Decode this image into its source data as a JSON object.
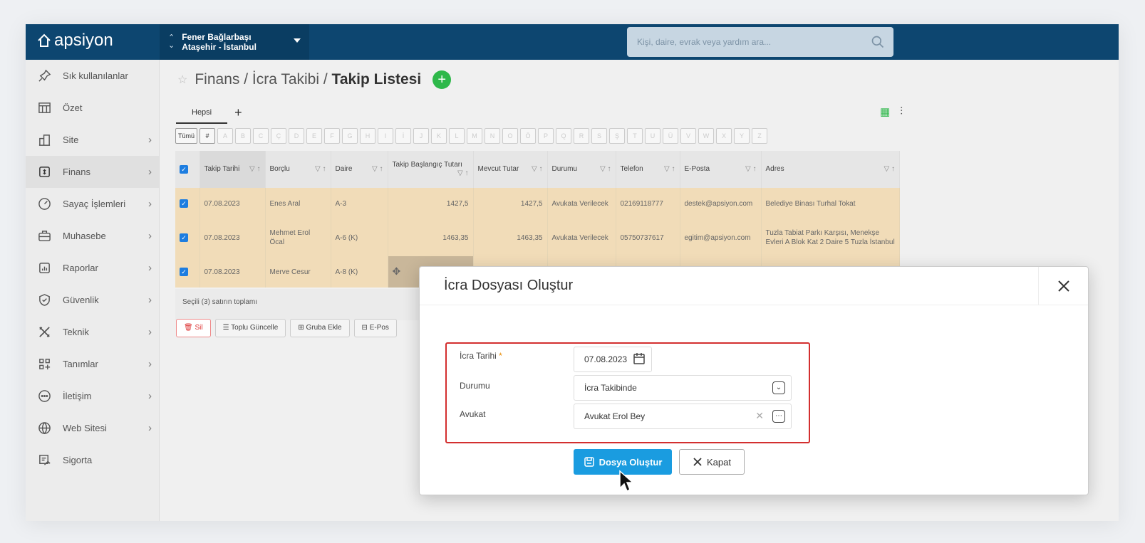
{
  "brand": "apsiyon",
  "site": {
    "name": "Fener Bağlarbaşı",
    "location": "Ataşehir - İstanbul"
  },
  "search": {
    "placeholder": "Kişi, daire, evrak veya yardım ara..."
  },
  "sidebar": {
    "items": [
      {
        "label": "Sık kullanılanlar",
        "icon": "pin-icon",
        "chevron": false
      },
      {
        "label": "Özet",
        "icon": "summary-icon",
        "chevron": false
      },
      {
        "label": "Site",
        "icon": "building-icon",
        "chevron": true
      },
      {
        "label": "Finans",
        "icon": "finance-icon",
        "chevron": true,
        "active": true
      },
      {
        "label": "Sayaç İşlemleri",
        "icon": "meter-icon",
        "chevron": true
      },
      {
        "label": "Muhasebe",
        "icon": "briefcase-icon",
        "chevron": true
      },
      {
        "label": "Raporlar",
        "icon": "report-icon",
        "chevron": true
      },
      {
        "label": "Güvenlik",
        "icon": "shield-icon",
        "chevron": true
      },
      {
        "label": "Teknik",
        "icon": "tools-icon",
        "chevron": true
      },
      {
        "label": "Tanımlar",
        "icon": "grid-icon",
        "chevron": true
      },
      {
        "label": "İletişim",
        "icon": "chat-icon",
        "chevron": true
      },
      {
        "label": "Web Sitesi",
        "icon": "globe-icon",
        "chevron": true
      },
      {
        "label": "Sigorta",
        "icon": "insurance-icon",
        "chevron": false
      }
    ]
  },
  "breadcrumb": {
    "part1": "Finans / İcra Takibi / ",
    "current": "Takip Listesi"
  },
  "tabs": {
    "all": "Hepsi",
    "add": "+"
  },
  "letters": [
    "Tümü",
    "#",
    "A",
    "B",
    "C",
    "Ç",
    "D",
    "E",
    "F",
    "G",
    "H",
    "I",
    "İ",
    "J",
    "K",
    "L",
    "M",
    "N",
    "O",
    "Ö",
    "P",
    "Q",
    "R",
    "S",
    "Ş",
    "T",
    "U",
    "Ü",
    "V",
    "W",
    "X",
    "Y",
    "Z"
  ],
  "table": {
    "headers": [
      "Takip Tarihi",
      "Borçlu",
      "Daire",
      "Takip Başlangıç Tutarı",
      "Mevcut Tutar",
      "Durumu",
      "Telefon",
      "E-Posta",
      "Adres"
    ],
    "rows": [
      {
        "date": "07.08.2023",
        "debtor": "Enes Aral",
        "unit": "A-3",
        "start": "1427,5",
        "current": "1427,5",
        "status": "Avukata Verilecek",
        "phone": "02169118777",
        "email": "destek@apsiyon.com",
        "address": "Belediye Binası Turhal Tokat"
      },
      {
        "date": "07.08.2023",
        "debtor": "Mehmet Erol Öcal",
        "unit": "A-6 (K)",
        "start": "1463,35",
        "current": "1463,35",
        "status": "Avukata Verilecek",
        "phone": "05750737617",
        "email": "egitim@apsiyon.com",
        "address": "Tuzla Tabiat Parkı Karşısı, Menekşe Evleri A Blok Kat 2 Daire 5 Tuzla İstanbul"
      },
      {
        "date": "07.08.2023",
        "debtor": "Merve Cesur",
        "unit": "A-8 (K)"
      }
    ],
    "summary": "Seçili (3) satırın toplamı"
  },
  "actions": {
    "delete": "Sil",
    "bulk_update": "Toplu Güncelle",
    "add_group": "Gruba Ekle",
    "eposta": "E-Pos"
  },
  "modal": {
    "title": "İcra Dosyası Oluştur",
    "fields": {
      "date_label": "İcra Tarihi",
      "date_value": "07.08.2023",
      "status_label": "Durumu",
      "status_value": "İcra Takibinde",
      "lawyer_label": "Avukat",
      "lawyer_value": "Avukat Erol Bey"
    },
    "create_button": "Dosya Oluştur",
    "close_button": "Kapat"
  },
  "colors": {
    "topbar": "#0d4670",
    "primary": "#1a9ce0",
    "success": "#2eb84a",
    "highlight_row": "#f1dcb8",
    "error": "#d32f2f"
  }
}
